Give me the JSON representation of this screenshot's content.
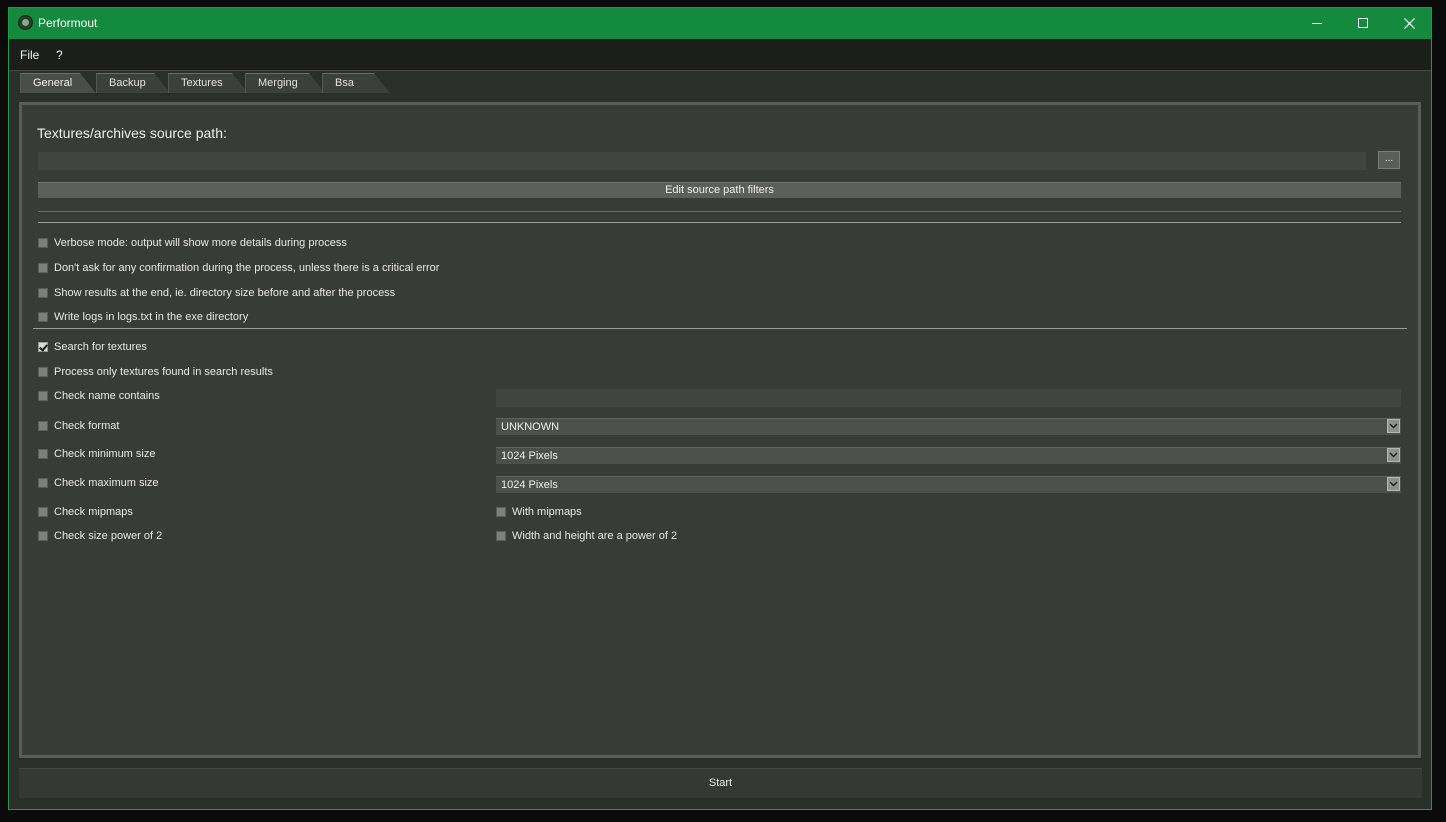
{
  "window": {
    "title": "Performout",
    "accent_color": "#138a3e",
    "controls": {
      "minimize_icon": "minimize-icon",
      "maximize_icon": "maximize-icon",
      "close_icon": "close-icon"
    }
  },
  "menu": {
    "items": [
      "File",
      "?"
    ]
  },
  "tabs": [
    {
      "label": "General",
      "active": true
    },
    {
      "label": "Backup",
      "active": false
    },
    {
      "label": "Textures",
      "active": false
    },
    {
      "label": "Merging",
      "active": false
    },
    {
      "label": "Bsa",
      "active": false
    }
  ],
  "general": {
    "source_path_title": "Textures/archives source path:",
    "source_path_value": "",
    "browse_label": "...",
    "edit_filters_label": "Edit source path filters",
    "options": [
      {
        "label": "Verbose mode: output will show more details during process",
        "checked": false
      },
      {
        "label": "Don't ask for any confirmation during the process, unless there is a critical error",
        "checked": false
      },
      {
        "label": "Show results at the end, ie. directory size before and after the process",
        "checked": false
      },
      {
        "label": "Write logs in logs.txt in the exe directory",
        "checked": false
      }
    ],
    "search": [
      {
        "label": "Search for textures",
        "checked": true
      },
      {
        "label": "Process only textures found in search results",
        "checked": false
      },
      {
        "label": "Check name contains",
        "checked": false,
        "input_value": ""
      },
      {
        "label": "Check format",
        "checked": false,
        "select_value": "UNKNOWN"
      },
      {
        "label": "Check minimum size",
        "checked": false,
        "select_value": "1024 Pixels"
      },
      {
        "label": "Check maximum size",
        "checked": false,
        "select_value": "1024 Pixels"
      },
      {
        "label": "Check mipmaps",
        "checked": false,
        "sub_label": "With mipmaps",
        "sub_checked": false
      },
      {
        "label": "Check size power of 2",
        "checked": false,
        "sub_label": "Width and height are a power of 2",
        "sub_checked": false
      }
    ]
  },
  "start_label": "Start"
}
